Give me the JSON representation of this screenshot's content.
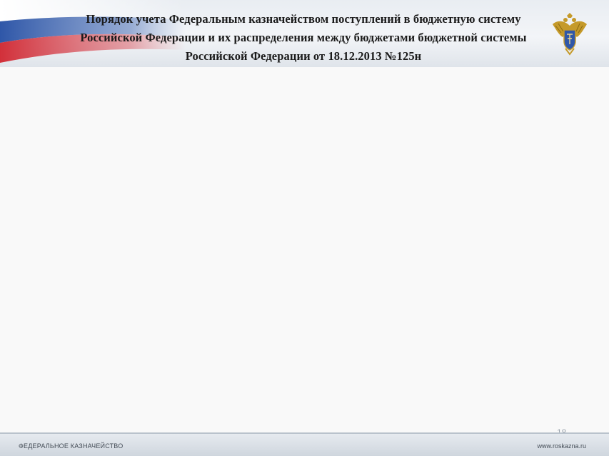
{
  "slide": {
    "title_lines": [
      "Порядок учета Федеральным казначейством поступлений в бюджетную систему",
      "Российской Федерации и их распределения между бюджетами бюджетной системы",
      "Российской Федерации от 18.12.2013 №125н"
    ],
    "page_number": "18"
  },
  "footer": {
    "left_text": "ФЕДЕРАЛЬНОЕ КАЗНАЧЕЙСТВО",
    "right_text": "www.roskazna.ru"
  },
  "colors": {
    "flag_white": "#ffffff",
    "flag_blue": "#2f57a8",
    "flag_red": "#d2303a",
    "emblem_gold": "#c59a2a"
  }
}
